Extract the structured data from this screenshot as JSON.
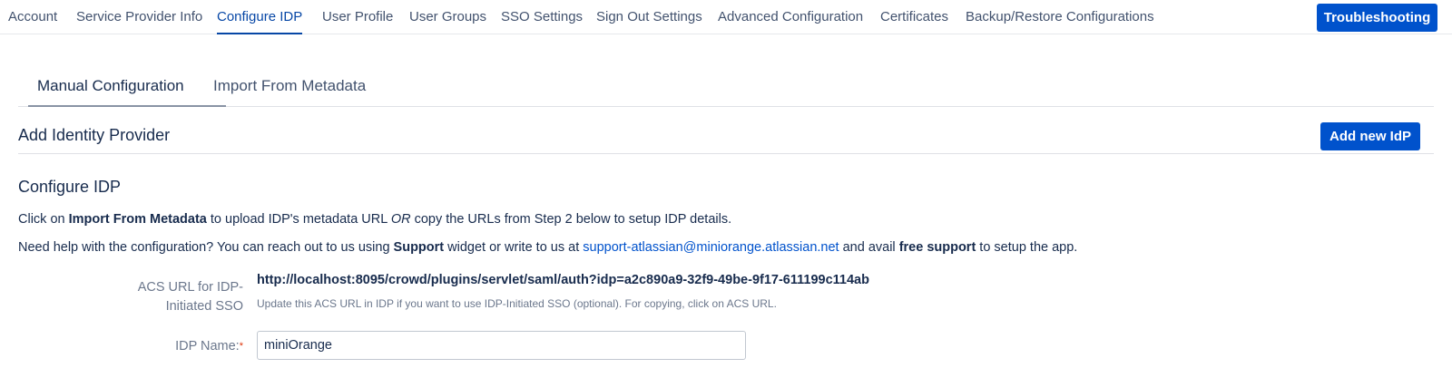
{
  "nav": {
    "tabs": [
      {
        "label": "Account"
      },
      {
        "label": "Service Provider Info"
      },
      {
        "label": "Configure IDP"
      },
      {
        "label": "User Profile"
      },
      {
        "label": "User Groups"
      },
      {
        "label": "SSO Settings"
      },
      {
        "label": "Sign Out Settings"
      },
      {
        "label": "Advanced Configuration"
      },
      {
        "label": "Certificates"
      },
      {
        "label": "Backup/Restore Configurations"
      }
    ],
    "active_tab": "Configure IDP",
    "troubleshooting_label": "Troubleshooting"
  },
  "subtabs": [
    {
      "label": "Manual Configuration"
    },
    {
      "label": "Import From Metadata"
    }
  ],
  "add_idp": {
    "title": "Add Identity Provider",
    "button_label": "Add new IdP"
  },
  "configure": {
    "title": "Configure IDP",
    "line1": {
      "prefix": "Click on ",
      "bold": "Import From Metadata",
      "middle": " to upload IDP's metadata URL ",
      "italic": "OR",
      "suffix": " copy the URLs from Step 2 below to setup IDP details."
    },
    "line2": {
      "prefix": "Need help with the configuration? You can reach out to us using ",
      "bold1": "Support",
      "middle": " widget or write to us at ",
      "email": "support-atlassian@miniorange.atlassian.net",
      "middle2": " and avail ",
      "bold2": "free support",
      "suffix": " to setup the app."
    }
  },
  "acs": {
    "label": "ACS URL for IDP-Initiated SSO",
    "url": "http://localhost:8095/crowd/plugins/servlet/saml/auth?idp=a2c890a9-32f9-49be-9f17-611199c114ab",
    "help": "Update this ACS URL in IDP if you want to use IDP-Initiated SSO (optional). For copying, click on ACS URL."
  },
  "idp_name": {
    "label": "IDP Name:",
    "required_mark": "*",
    "value": "miniOrange"
  },
  "colors": {
    "primary": "#0052cc",
    "active_tab": "#0747a6",
    "text": "#172b4d",
    "muted": "#6b778c",
    "required": "#de350b"
  }
}
